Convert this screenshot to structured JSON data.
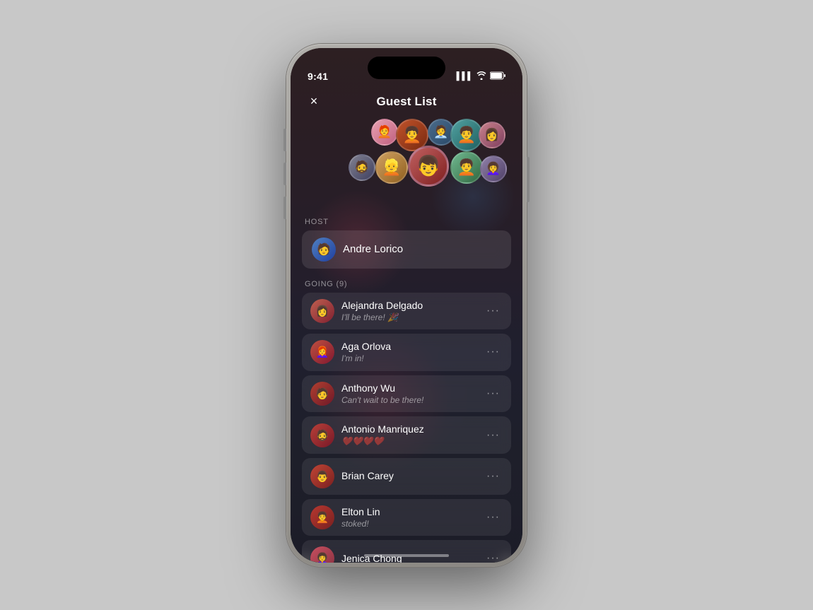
{
  "phone": {
    "status_bar": {
      "time": "9:41",
      "signal": "▌▌▌",
      "wifi": "wifi",
      "battery": "battery"
    },
    "nav": {
      "title": "Guest List",
      "close_label": "×"
    },
    "avatars": [
      {
        "emoji": "🧑‍🦰",
        "class": "av1",
        "size": "small",
        "top": "0",
        "left": "80"
      },
      {
        "emoji": "🧑‍🦱",
        "class": "av2",
        "size": "medium",
        "top": "0",
        "left": "115"
      },
      {
        "emoji": "🧑‍💼",
        "class": "av3",
        "size": "small",
        "top": "0",
        "left": "158"
      },
      {
        "emoji": "🧑‍🦱",
        "class": "av4",
        "size": "medium",
        "top": "0",
        "left": "192"
      },
      {
        "emoji": "👩",
        "class": "av5",
        "size": "small",
        "top": "0",
        "left": "228"
      },
      {
        "emoji": "🧔",
        "class": "av6",
        "size": "small",
        "top": "50",
        "left": "50"
      },
      {
        "emoji": "👱",
        "class": "av7",
        "size": "medium",
        "top": "45",
        "left": "90"
      },
      {
        "emoji": "👦",
        "class": "av10",
        "size": "large",
        "top": "38",
        "left": "135"
      },
      {
        "emoji": "🧑‍🦱",
        "class": "av8",
        "size": "medium",
        "top": "45",
        "left": "192"
      },
      {
        "emoji": "👩‍🦱",
        "class": "av9",
        "size": "small",
        "top": "50",
        "left": "235"
      }
    ],
    "host_section": {
      "label": "HOST",
      "host": {
        "name": "Andre Lorico",
        "emoji": "🧑"
      }
    },
    "going_section": {
      "label": "GOING (9)",
      "guests": [
        {
          "name": "Alejandra Delgado",
          "status": "I'll be there! 🎉",
          "emoji": "👩",
          "bg": "linear-gradient(135deg, #c06050, #802030)"
        },
        {
          "name": "Aga Orlova",
          "status": "I'm in!",
          "emoji": "👩‍🦰",
          "bg": "linear-gradient(135deg, #c05040, #801830)"
        },
        {
          "name": "Anthony Wu",
          "status": "Can't wait to be there!",
          "emoji": "🧑",
          "bg": "linear-gradient(135deg, #b04030, #701828)"
        },
        {
          "name": "Antonio Manriquez",
          "status": "❤️❤️❤️❤️",
          "emoji": "🧔",
          "bg": "linear-gradient(135deg, #b84038, #781828)"
        },
        {
          "name": "Brian Carey",
          "status": "",
          "emoji": "👨",
          "bg": "linear-gradient(135deg, #c04535, #7a2020)"
        },
        {
          "name": "Elton Lin",
          "status": "stoked!",
          "emoji": "🧑‍🦱",
          "bg": "linear-gradient(135deg, #b83830, #782020)"
        },
        {
          "name": "Jenica Chong",
          "status": "",
          "emoji": "👩‍🦱",
          "bg": "linear-gradient(135deg, #c85060, #883040)"
        }
      ]
    }
  }
}
